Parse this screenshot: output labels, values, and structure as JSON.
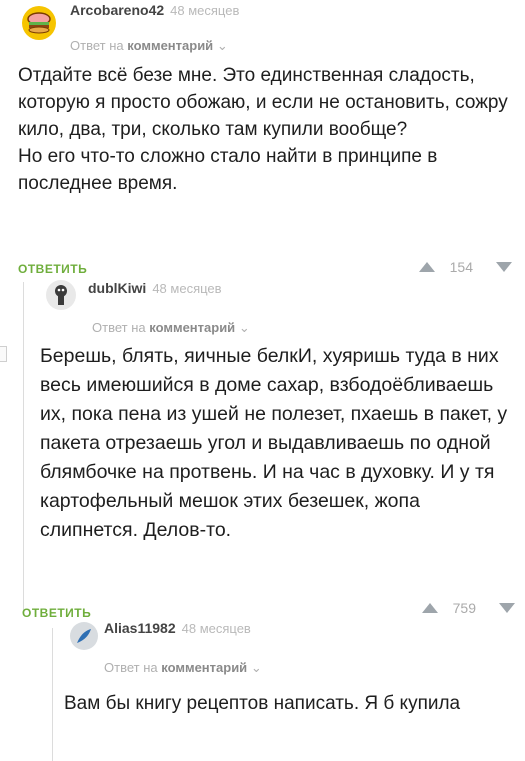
{
  "comments": [
    {
      "author": "Arcobareno42",
      "time": "48 месяцев",
      "reply_prefix": "Ответ на",
      "reply_target": "комментарий",
      "body": "Отдайте всё безе мне. Это единственная сладость, которую я просто обожаю, и если не остановить, сожру кило, два, три, сколько там купили вообще?\nНо его что-то сложно стало найти в принципе в последнее время.",
      "reply_button": "ОТВЕТИТЬ",
      "rating": "154"
    },
    {
      "author": "dublKiwi",
      "time": "48 месяцев",
      "reply_prefix": "Ответ на",
      "reply_target": "комментарий",
      "body": "Берешь, блять, яичные белкИ, хуяришь туда в них весь имеюшийся в доме сахар, взбодоёбливаешь их, пока пена из ушей не полезет, пхаешь в пакет, у пакета отрезаешь угол и выдавливаешь по одной блямбочке на протвень. И на час в духовку. И у тя картофельный мешок этих безешек, жопа слипнется. Делов-то.",
      "reply_button": "ОТВЕТИТЬ",
      "rating": "759"
    },
    {
      "author": "Alias11982",
      "time": "48 месяцев",
      "reply_prefix": "Ответ на",
      "reply_target": "комментарий",
      "body": "Вам бы книгу рецептов написать. Я б купила"
    }
  ],
  "icons": {
    "upvote": "triangle-up-icon",
    "downvote": "triangle-down-icon",
    "dropdown": "chevron-down-icon"
  },
  "colors": {
    "reply_button": "#6fae3c",
    "muted": "#b9b9b9",
    "avatar1": "#f6c400"
  }
}
